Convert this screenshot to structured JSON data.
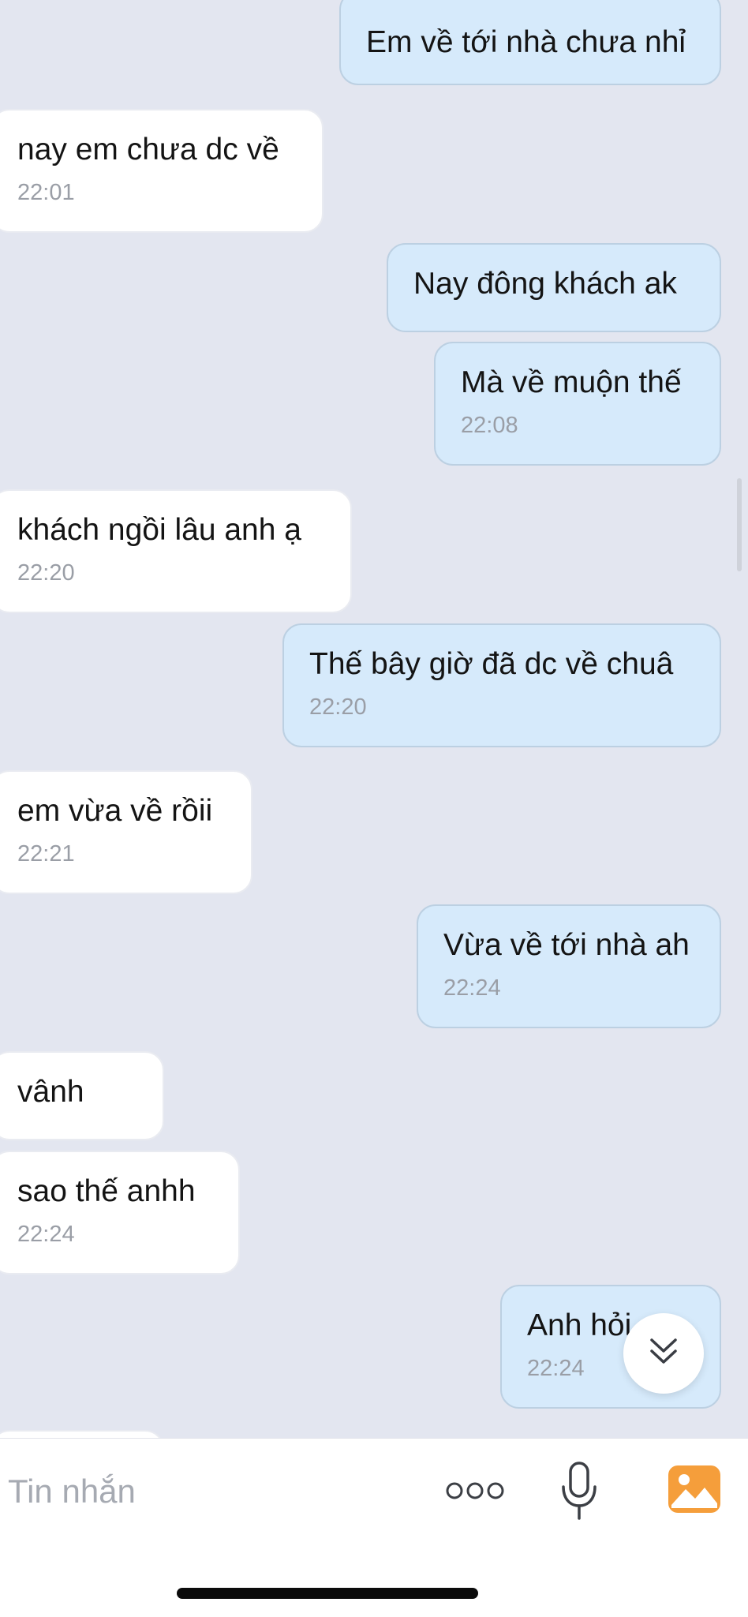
{
  "messages": [
    {
      "side": "out",
      "text": "Em về tới nhà chưa nhỉ",
      "time": ""
    },
    {
      "side": "in",
      "text": "nay em chưa dc về",
      "time": "22:01"
    },
    {
      "side": "out",
      "text": "Nay đông khách ak",
      "time": ""
    },
    {
      "side": "out",
      "text": "Mà về muộn thế",
      "time": "22:08"
    },
    {
      "side": "in",
      "text": "khách ngồi lâu anh ạ",
      "time": "22:20"
    },
    {
      "side": "out",
      "text": "Thế bây giờ đã dc về chuâ",
      "time": "22:20"
    },
    {
      "side": "in",
      "text": "em vừa về rồii",
      "time": "22:21"
    },
    {
      "side": "out",
      "text": "Vừa về tới nhà ah",
      "time": "22:24"
    },
    {
      "side": "in",
      "text": " vânh",
      "time": ""
    },
    {
      "side": "in",
      "text": "sao thế anhh",
      "time": "22:24"
    },
    {
      "side": "out",
      "text": "Anh hỏi",
      "time": "22:24"
    }
  ],
  "composer": {
    "placeholder": "Tin nhắn"
  },
  "icons": {
    "scroll_down": "double-chevron-down-icon",
    "more": "more-options-icon",
    "mic": "microphone-icon",
    "gallery": "image-gallery-icon"
  },
  "colors": {
    "background": "#e3e6f0",
    "incoming_bubble": "#ffffff",
    "outgoing_bubble": "#d6eafb",
    "gallery_accent": "#f59e3b"
  }
}
